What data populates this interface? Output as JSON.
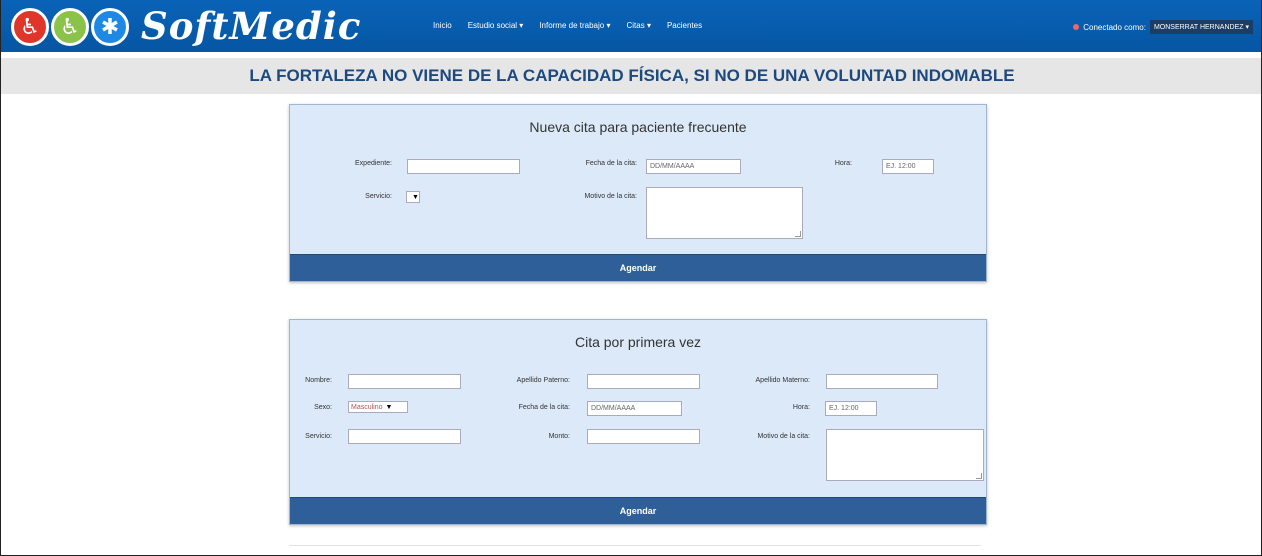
{
  "navbar": {
    "logo_icons": [
      "wheelchair-icon",
      "walking-cane-icon",
      "person-icon"
    ],
    "brand": "SoftMedic",
    "menu": [
      {
        "label": "Inicio"
      },
      {
        "label": "Estudio social"
      },
      {
        "label": "Informe de trabajo"
      },
      {
        "label": "Citas"
      },
      {
        "label": "Pacientes"
      }
    ],
    "connected_label": "Conectado como:",
    "user": "MONSERRAT HERNANDEZ",
    "colors": {
      "bar": "#0556a3",
      "user_button": "#1c3d66"
    }
  },
  "banner": {
    "text": "LA FORTALEZA NO VIENE DE LA CAPACIDAD FÍSICA, SI NO DE UNA VOLUNTAD INDOMABLE"
  },
  "frequent": {
    "title": "Nueva cita para paciente frecuente",
    "expediente_label": "Expediente:",
    "expediente_value": "",
    "fecha_label": "Fecha de la cita:",
    "fecha_placeholder": "DD/MM/AAAA",
    "hora_label": "Hora:",
    "hora_placeholder": "EJ. 12:00",
    "servicio_label": "Servicio:",
    "servicio_value": "",
    "motivo_label": "Motivo de la cita:",
    "submit_label": "Agendar"
  },
  "first_time": {
    "title": "Cita por primera vez",
    "nombre_label": "Nombre:",
    "paterno_label": "Apellido Paterno:",
    "materno_label": "Apellido Materno:",
    "sexo_label": "Sexo:",
    "sexo_value": "Masculino",
    "fecha_label": "Fecha de la cita:",
    "fecha_placeholder": "DD/MM/AAAA",
    "hora_label": "Hora:",
    "hora_placeholder": "EJ. 12:00",
    "servicio_label": "Servicio:",
    "monto_label": "Monto:",
    "motivo_label": "Motivo de la cita:",
    "submit_label": "Agendar"
  },
  "colors": {
    "panel_bg": "#dce9f8",
    "panel_footer": "#2e5f98",
    "banner_text": "#1c4a80"
  }
}
